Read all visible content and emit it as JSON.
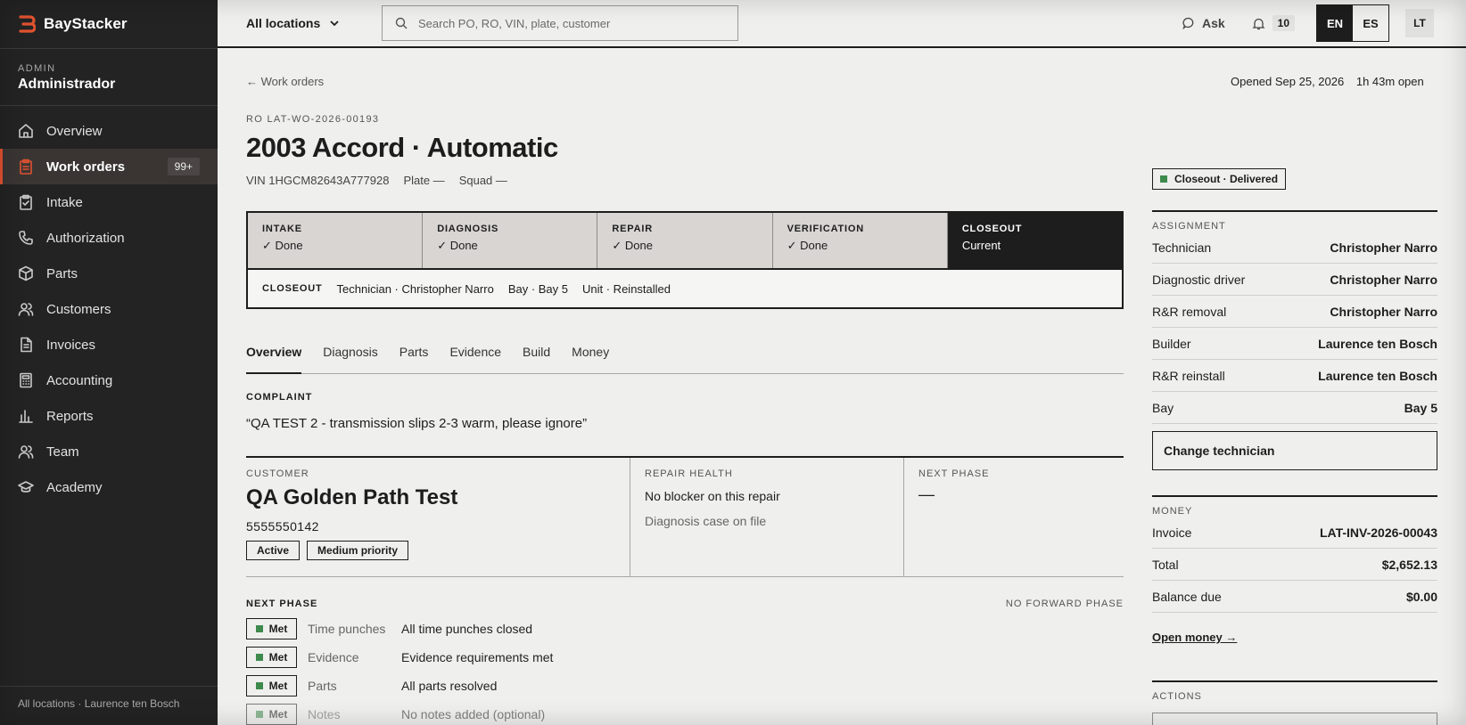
{
  "app": {
    "name": "BayStacker"
  },
  "role": {
    "tag": "ADMIN",
    "title": "Administrador"
  },
  "nav": [
    {
      "label": "Overview",
      "icon": "home-icon"
    },
    {
      "label": "Work orders",
      "icon": "clipboard-icon",
      "badge": "99+",
      "active": true
    },
    {
      "label": "Intake",
      "icon": "clipboard-check-icon"
    },
    {
      "label": "Authorization",
      "icon": "phone-icon"
    },
    {
      "label": "Parts",
      "icon": "box-icon"
    },
    {
      "label": "Customers",
      "icon": "users-icon"
    },
    {
      "label": "Invoices",
      "icon": "document-icon"
    },
    {
      "label": "Accounting",
      "icon": "calculator-icon"
    },
    {
      "label": "Reports",
      "icon": "bar-chart-icon"
    },
    {
      "label": "Team",
      "icon": "users-icon"
    },
    {
      "label": "Academy",
      "icon": "graduation-cap-icon"
    }
  ],
  "sidebar_footer": "All locations · Laurence ten Bosch",
  "topbar": {
    "location": "All locations",
    "search_placeholder": "Search PO, RO, VIN, plate, customer",
    "ask": "Ask",
    "notifications": "10",
    "lang_en": "EN",
    "lang_es": "ES",
    "avatar": "LT"
  },
  "header": {
    "back": "← Work orders",
    "opened": "Opened Sep 25, 2026",
    "open_duration": "1h 43m open",
    "ro": "RO LAT-WO-2026-00193",
    "vehicle": "2003 Accord · Automatic",
    "vin": "VIN 1HGCM82643A777928",
    "plate": "Plate —",
    "squad": "Squad —"
  },
  "phases": [
    {
      "label": "INTAKE",
      "status": "✓ Done"
    },
    {
      "label": "DIAGNOSIS",
      "status": "✓ Done"
    },
    {
      "label": "REPAIR",
      "status": "✓ Done"
    },
    {
      "label": "VERIFICATION",
      "status": "✓ Done"
    },
    {
      "label": "CLOSEOUT",
      "status": "Current"
    }
  ],
  "closeout": {
    "label": "CLOSEOUT",
    "technician": "Technician · Christopher Narro",
    "bay": "Bay · Bay 5",
    "unit": "Unit · Reinstalled"
  },
  "tabs": [
    "Overview",
    "Diagnosis",
    "Parts",
    "Evidence",
    "Build",
    "Money"
  ],
  "complaint": {
    "label": "COMPLAINT",
    "text": "“QA TEST 2 - transmission slips 2-3 warm, please ignore”"
  },
  "customer": {
    "label": "CUSTOMER",
    "name": "QA Golden Path Test",
    "phone": "5555550142",
    "chip_active": "Active",
    "chip_priority": "Medium priority"
  },
  "repair_health": {
    "label": "REPAIR HEALTH",
    "line1": "No blocker on this repair",
    "line2": "Diagnosis case on file"
  },
  "next_phase_card": {
    "label": "NEXT PHASE",
    "value": "—"
  },
  "next_phase": {
    "label": "NEXT PHASE",
    "forward": "NO FORWARD PHASE",
    "requirements": [
      {
        "status": "Met",
        "key": "Time punches",
        "value": "All time punches closed"
      },
      {
        "status": "Met",
        "key": "Evidence",
        "value": "Evidence requirements met"
      },
      {
        "status": "Met",
        "key": "Parts",
        "value": "All parts resolved"
      },
      {
        "status": "Met",
        "key": "Notes",
        "value": "No notes added (optional)"
      }
    ]
  },
  "status_pill": "Closeout · Delivered",
  "assignment": {
    "title": "ASSIGNMENT",
    "rows": [
      {
        "k": "Technician",
        "v": "Christopher Narro"
      },
      {
        "k": "Diagnostic driver",
        "v": "Christopher Narro"
      },
      {
        "k": "R&R removal",
        "v": "Christopher Narro"
      },
      {
        "k": "Builder",
        "v": "Laurence ten Bosch"
      },
      {
        "k": "R&R reinstall",
        "v": "Laurence ten Bosch"
      },
      {
        "k": "Bay",
        "v": "Bay 5"
      }
    ],
    "change_button": "Change technician"
  },
  "money": {
    "title": "MONEY",
    "rows": [
      {
        "k": "Invoice",
        "v": "LAT-INV-2026-00043"
      },
      {
        "k": "Total",
        "v": "$2,652.13"
      },
      {
        "k": "Balance due",
        "v": "$0.00"
      }
    ],
    "link": "Open money →"
  },
  "actions": {
    "title": "ACTIONS"
  },
  "colors": {
    "accent": "#e0522f",
    "sidebar": "#232323",
    "met": "#3e8a4d"
  }
}
